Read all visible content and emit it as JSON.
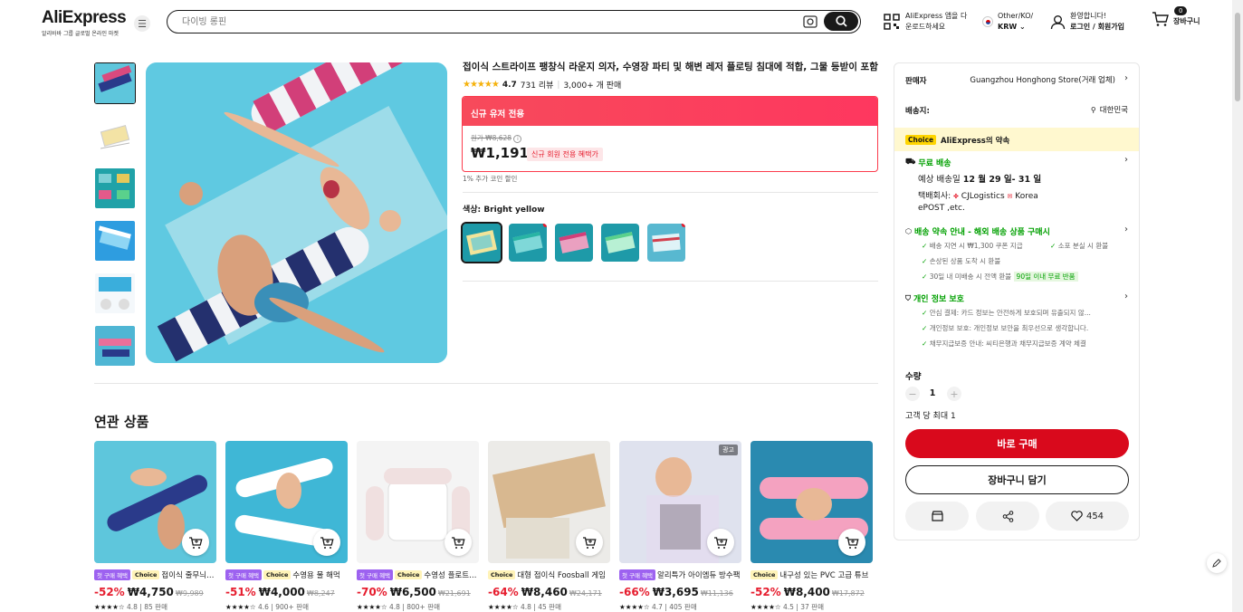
{
  "header": {
    "logo": "AliExpress",
    "logo_sub": "알리바바 그룹 글로벌 온라인 마켓",
    "search_placeholder": "다이빙 롱핀",
    "app_download_line1": "AliExpress 앱을 다",
    "app_download_line2": "운로드하세요",
    "region_line1": "Other/KO/",
    "region_line2": "KRW",
    "account_line1": "환영합니다!",
    "account_line2": "로그인 / 회원가입",
    "cart_count": "0",
    "cart_label": "장바구니"
  },
  "product": {
    "title": "접이식 스트라이프 팽창식 라운지 의자, 수영장 파티 및 해변 레저 플로팅 침대에 적합, 그물 등받이 포함",
    "rating": "4.7",
    "reviews": "731 리뷰",
    "sold": "3,000+ 개 판매",
    "promo_header": "신규 유저 전용",
    "original_price": "원가 ₩8,628",
    "price": "₩1,191",
    "new_member_tag": "신규 회원 전용 혜택가",
    "coin_discount": "1% 추가 코인 할인",
    "color_label": "색상:",
    "color_value": "Bright yellow"
  },
  "related": {
    "heading": "연관 상품",
    "items": [
      {
        "tag1": "첫 구매 혜택",
        "tag2": "Choice",
        "title": "접이식 줄무늬 수영장",
        "disc": "-52%",
        "price": "₩4,750",
        "old": "₩9,989",
        "meta": "4.8 | 85 판매",
        "ad": ""
      },
      {
        "tag1": "첫 구매 혜택",
        "tag2": "Choice",
        "title": "수영용 물 해먹",
        "disc": "-51%",
        "price": "₩4,000",
        "old": "₩8,247",
        "meta": "4.6 | 900+ 판매",
        "ad": ""
      },
      {
        "tag1": "첫 구매 혜택",
        "tag2": "Choice",
        "title": "수영성 플로트 의자",
        "disc": "-70%",
        "price": "₩6,500",
        "old": "₩21,691",
        "meta": "4.8 | 800+ 판매",
        "ad": ""
      },
      {
        "tag1": "",
        "tag2": "Choice",
        "title": "대형 접이식 Foosball 게임",
        "disc": "-64%",
        "price": "₩8,460",
        "old": "₩24,171",
        "meta": "4.8 | 45 판매",
        "ad": ""
      },
      {
        "tag1": "첫 구매 혜택",
        "tag2": "",
        "title": "알리특가 아이엠듀 방수팩",
        "disc": "-66%",
        "price": "₩3,695",
        "old": "₩11,136",
        "meta": "4.7 | 405 판매",
        "ad": "광고"
      },
      {
        "tag1": "",
        "tag2": "Choice",
        "title": "내구성 있는 PVC 고급 튜브",
        "disc": "-52%",
        "price": "₩8,400",
        "old": "₩17,872",
        "meta": "4.5 | 37 판매",
        "ad": ""
      }
    ]
  },
  "panel": {
    "seller_label": "판매자",
    "seller_name": "Guangzhou Honghong Store(거래 업체)",
    "ship_to_label": "배송지:",
    "ship_to": "대한민국",
    "choice_badge": "Choice",
    "choice_title": "AliExpress의 약속",
    "free_ship": "무료 배송",
    "eta_prefix": "예상 배송일",
    "eta": "12 월 29 일- 31 일",
    "carrier_label": "택배회사:",
    "carrier": "CJLogistics",
    "carrier2": "Korea",
    "carrier3": "ePOST ,etc.",
    "promise_title": "배송 약속 안내 - 해외 배송 상품 구매시",
    "promise_1": "배송 지연 시 ₩1,300 쿠폰 지급",
    "promise_2": "소포 분실 시 환불",
    "promise_3": "손상된 상품 도착 시 환불",
    "promise_4": "30일 내 미배송 시 전액 환불",
    "promise_badge": "90일 이내 무료 반품",
    "privacy_title": "개인 정보 보호",
    "privacy_1": "안심 결제: 카드 정보는 안전하게 보호되며 유출되지 않...",
    "privacy_2": "개인정보 보호: 개인정보 보안을 최우선으로 생각합니다.",
    "privacy_3": "채무지급보증 안내: 씨티은행과 채무지급보증 계약 체결",
    "qty_label": "수량",
    "qty_value": "1",
    "qty_limit": "고객 당 최대 1",
    "buy_now": "바로 구매",
    "add_cart": "장바구니 담기",
    "wish_count": "454"
  },
  "colors": {
    "accent_red": "#d9091c",
    "choice_yellow": "#ffd500",
    "green": "#00a000"
  }
}
